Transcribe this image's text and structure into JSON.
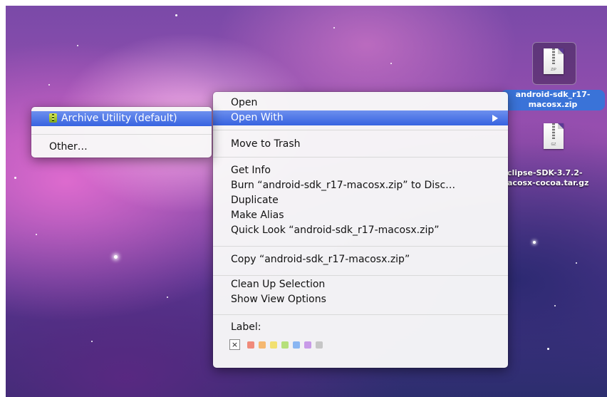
{
  "desktop": {
    "icons": [
      {
        "label": "android-sdk_r17-macosx.zip",
        "label_lines": [
          "android-sdk_r17-",
          "macosx.zip"
        ],
        "ext": "ZIP",
        "selected": true,
        "icon": "zip-archive-icon"
      },
      {
        "label": "eclipse-SDK-3.7.2-macosx-cocoa.tar.gz",
        "label_lines": [
          "clipse-SDK-3.7.2-",
          "acosx-cocoa.tar.gz"
        ],
        "ext": "GZ",
        "selected": false,
        "icon": "gz-archive-icon"
      }
    ]
  },
  "context_menu": {
    "open": "Open",
    "open_with": "Open With",
    "move_to_trash": "Move to Trash",
    "get_info": "Get Info",
    "burn": "Burn “android-sdk_r17-macosx.zip” to Disc…",
    "duplicate": "Duplicate",
    "make_alias": "Make Alias",
    "quick_look": "Quick Look “android-sdk_r17-macosx.zip”",
    "copy": "Copy “android-sdk_r17-macosx.zip”",
    "clean_up": "Clean Up Selection",
    "show_view_options": "Show View Options",
    "label_heading": "Label:",
    "label_none": "×",
    "label_colors": [
      "#f08a7a",
      "#f5b870",
      "#f2e070",
      "#b6e07a",
      "#8ab6f2",
      "#c89ae8",
      "#c6c6c6"
    ]
  },
  "submenu": {
    "archive_utility": "Archive Utility (default)",
    "other": "Other…",
    "icon": "archive-utility-icon"
  }
}
